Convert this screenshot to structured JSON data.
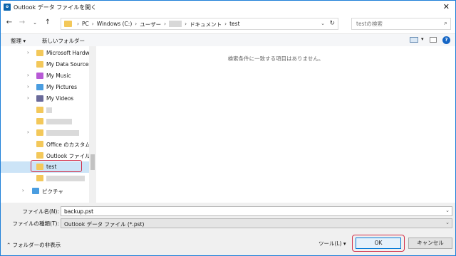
{
  "window": {
    "title": "Outlook データ ファイルを開く",
    "app_icon": "o"
  },
  "address": {
    "crumbs": [
      "PC",
      "Windows (C:)",
      "ユーザー",
      "ドキュメント",
      "test"
    ],
    "separator": "›"
  },
  "search": {
    "placeholder": "testの検索"
  },
  "toolbar": {
    "organize": "整理 ▾",
    "new_folder": "新しいフォルダー"
  },
  "nav": {
    "items": [
      {
        "label": "Microsoft Hardw",
        "icon": "folder"
      },
      {
        "label": "My Data Sources",
        "icon": "folder"
      },
      {
        "label": "My Music",
        "icon": "music-folder"
      },
      {
        "label": "My Pictures",
        "icon": "pictures-folder"
      },
      {
        "label": "My Videos",
        "icon": "videos-folder"
      },
      {
        "label": "",
        "icon": "folder"
      },
      {
        "label": "",
        "icon": "folder"
      },
      {
        "label": "",
        "icon": "folder"
      },
      {
        "label": "Office のカスタム テ",
        "icon": "folder"
      },
      {
        "label": "Outlook ファイル",
        "icon": "folder"
      },
      {
        "label": "test",
        "icon": "folder"
      },
      {
        "label": "",
        "icon": "folder"
      },
      {
        "label": "ピクチャ",
        "icon": "pictures-library"
      }
    ]
  },
  "content": {
    "empty_message": "検索条件に一致する項目はありません。"
  },
  "fields": {
    "filename_label": "ファイル名(N):",
    "filename_value": "backup.pst",
    "filetype_label": "ファイルの種類(T):",
    "filetype_value": "Outlook データ ファイル (*.pst)"
  },
  "footer": {
    "hide_folders": "フォルダーの非表示",
    "tools": "ツール(L)",
    "ok": "OK",
    "cancel": "キャンセル"
  },
  "colors": {
    "accent": "#0078d7",
    "highlight_outline": "#d0304a",
    "selected_bg": "#cce4f7"
  }
}
